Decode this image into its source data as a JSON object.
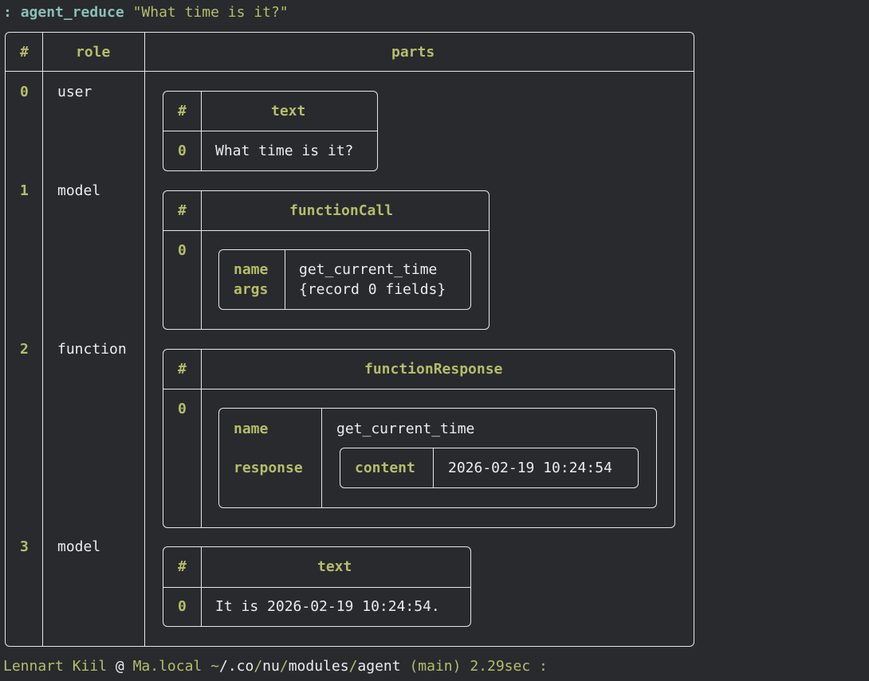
{
  "command": {
    "prompt": ":",
    "name": "agent_reduce",
    "arg": "\"What time is it?\""
  },
  "table": {
    "headers": {
      "index": "#",
      "role": "role",
      "parts": "parts"
    },
    "rows": [
      {
        "index": "0",
        "role": "user",
        "parts": {
          "headers": {
            "index": "#",
            "col": "text"
          },
          "rows": [
            {
              "index": "0",
              "value": "What time is it?"
            }
          ]
        }
      },
      {
        "index": "1",
        "role": "model",
        "parts": {
          "headers": {
            "index": "#",
            "col": "functionCall"
          },
          "rows": [
            {
              "index": "0",
              "name_key": "name",
              "name_value": "get_current_time",
              "args_key": "args",
              "args_value": "{record 0 fields}"
            }
          ]
        }
      },
      {
        "index": "2",
        "role": "function",
        "parts": {
          "headers": {
            "index": "#",
            "col": "functionResponse"
          },
          "rows": [
            {
              "index": "0",
              "name_key": "name",
              "name_value": "get_current_time",
              "response_key": "response",
              "content_key": "content",
              "content_value": "2026-02-19 10:24:54"
            }
          ]
        }
      },
      {
        "index": "3",
        "role": "model",
        "parts": {
          "headers": {
            "index": "#",
            "col": "text"
          },
          "rows": [
            {
              "index": "0",
              "value": "It is 2026-02-19 10:24:54."
            }
          ]
        }
      }
    ]
  },
  "status": {
    "user": "Lennart Kiil",
    "at": "@",
    "host": "Ma.local",
    "path_parts": [
      "~",
      "/",
      ".co",
      "/",
      "nu",
      "/",
      "modules",
      "/",
      "agent"
    ],
    "branch": "(main)",
    "duration": "2.29sec",
    "prompt": ":"
  },
  "colors": {
    "background": "#282a2e",
    "border": "#e6e6e6",
    "header": "#b6bd68",
    "command": "#8abeb7",
    "text": "#ececec"
  }
}
